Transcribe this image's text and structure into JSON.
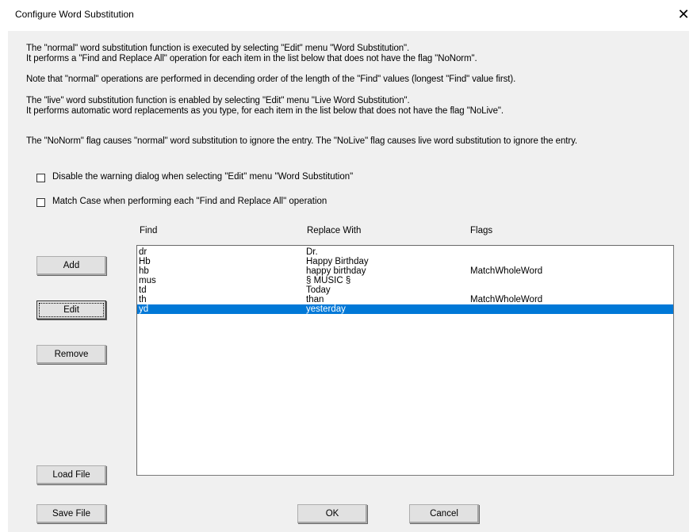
{
  "window": {
    "title": "Configure Word Substitution",
    "close_glyph": "✕"
  },
  "info": [
    "The \"normal\" word substitution function is executed by selecting \"Edit\" menu \"Word Substitution\".",
    "It performs a \"Find and Replace All\" operation for each item in the list below that does not have the flag \"NoNorm\".",
    "Note that \"normal\" operations are performed in decending order of the length of the \"Find\" values (longest \"Find\" value first).",
    "The \"live\" word substitution function is enabled by selecting \"Edit\" menu \"Live Word Substitution\".",
    "It performs automatic word replacements as you type, for each item in the list below that does not have the flag \"NoLive\".",
    "The \"NoNorm\" flag causes \"normal\" word substitution to ignore the entry. The \"NoLive\" flag causes live word substitution to ignore the entry."
  ],
  "checkboxes": {
    "disable_warning": {
      "label": "Disable the warning dialog when selecting \"Edit\" menu \"Word Substitution\"",
      "checked": false
    },
    "match_case": {
      "label": "Match Case when performing each \"Find and Replace All\" operation",
      "checked": false
    }
  },
  "table": {
    "headers": [
      "Find",
      "Replace With",
      "Flags"
    ],
    "rows": [
      {
        "find": "dr",
        "replace": "Dr.",
        "flags": ""
      },
      {
        "find": "Hb",
        "replace": "Happy Birthday",
        "flags": ""
      },
      {
        "find": "hb",
        "replace": "happy birthday",
        "flags": "MatchWholeWord"
      },
      {
        "find": "mus",
        "replace": "§ MUSIC §",
        "flags": ""
      },
      {
        "find": "td",
        "replace": "Today",
        "flags": ""
      },
      {
        "find": "th",
        "replace": "than",
        "flags": "MatchWholeWord"
      },
      {
        "find": "yd",
        "replace": "yesterday",
        "flags": ""
      }
    ],
    "selected_index": 6
  },
  "buttons": {
    "add": "Add",
    "edit": "Edit",
    "remove": "Remove",
    "load_file": "Load File",
    "save_file": "Save File",
    "ok": "OK",
    "cancel": "Cancel"
  },
  "colors": {
    "selection": "#0078d7",
    "dialog_bg": "#f0f0f0"
  }
}
